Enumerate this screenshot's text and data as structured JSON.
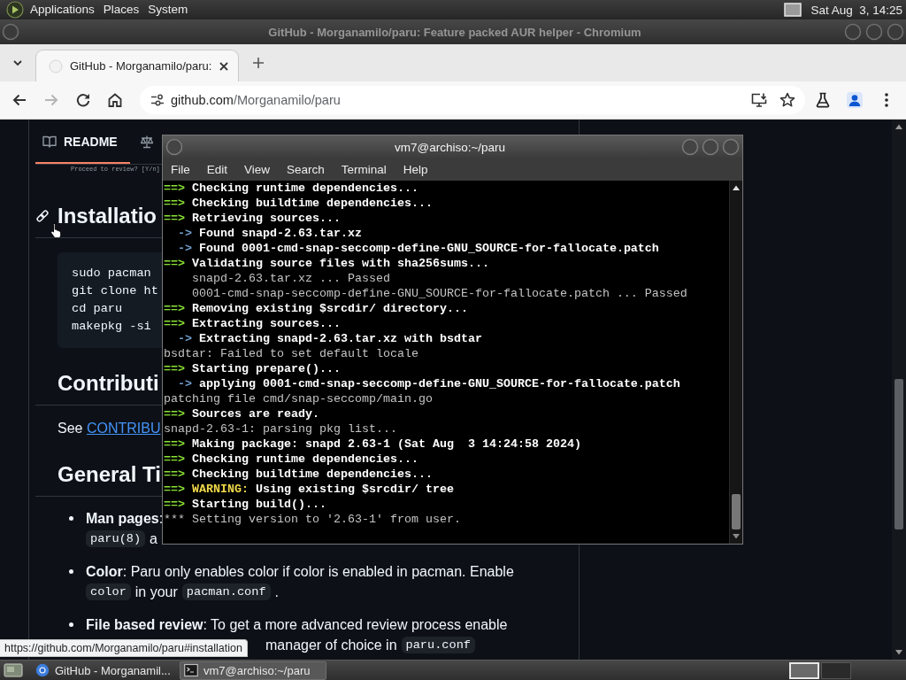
{
  "top_panel": {
    "menus": [
      "Applications",
      "Places",
      "System"
    ],
    "clock": "Sat Aug  3, 14:25"
  },
  "browser": {
    "title": "GitHub - Morganamilo/paru: Feature packed AUR helper - Chromium",
    "focused": false,
    "tabs": [
      {
        "title": "GitHub - Morganamilo/paru:",
        "selected": true
      }
    ],
    "toolbar": {
      "back_disabled": false,
      "forward_disabled": true
    },
    "address": {
      "host": "github.com",
      "path": "/Morganamilo/paru"
    },
    "page": {
      "readme_tabs": [
        {
          "label": "README",
          "selected": true
        },
        {
          "selected": false
        }
      ],
      "image_text": "Proceed to review? [Y/n]",
      "blocks": [
        {
          "kind": "heading",
          "text": "Installatio",
          "anchor_hovered": true
        },
        {
          "kind": "code",
          "lines": [
            "sudo pacman",
            "git clone ht",
            "cd paru",
            "makepkg -si"
          ]
        },
        {
          "kind": "heading",
          "text": "Contributi",
          "anchor_hovered": false
        },
        {
          "kind": "paragraph",
          "text": "See",
          "link": "CONTRIBU"
        },
        {
          "kind": "heading",
          "text": "General Ti",
          "anchor_hovered": false
        },
        {
          "kind": "list",
          "items": [
            {
              "lines": [
                [
                  {
                    "kind": "text",
                    "text": "**Man pages**:"
                  }
                ],
                [
                  {
                    "kind": "code",
                    "text": "paru(8)"
                  },
                  {
                    "kind": "text",
                    "text": "a"
                  }
                ]
              ]
            },
            {
              "lines": [
                [
                  {
                    "kind": "text",
                    "text": "**Color**: Paru only enables color if color is enabled in pacman. Enable"
                  }
                ],
                [
                  {
                    "kind": "code",
                    "text": "color"
                  },
                  {
                    "kind": "text",
                    "text": "in your"
                  },
                  {
                    "kind": "code",
                    "text": "pacman.conf"
                  },
                  {
                    "kind": "text",
                    "text": "."
                  }
                ]
              ]
            },
            {
              "lines": [
                [
                  {
                    "kind": "text",
                    "text": "**File based review**: To get a more advanced review process enable"
                  }
                ],
                [
                  {
                    "kind": "text",
                    "text": "manager of choice in"
                  },
                  {
                    "kind": "code",
                    "text": "paru.conf"
                  }
                ]
              ]
            }
          ]
        }
      ],
      "status_url": "https://github.com/Morganamilo/paru#installation"
    }
  },
  "terminal": {
    "title": "vm7@archiso:~/paru",
    "focused": true,
    "menus": [
      "File",
      "Edit",
      "View",
      "Search",
      "Terminal",
      "Help"
    ],
    "lines": [
      {
        "kind": "step",
        "marker": "==>",
        "text": "Checking runtime dependencies..."
      },
      {
        "kind": "step",
        "marker": "==>",
        "text": "Checking buildtime dependencies..."
      },
      {
        "kind": "step",
        "marker": "==>",
        "text": "Retrieving sources..."
      },
      {
        "kind": "substep",
        "marker": "->",
        "text": "Found snapd-2.63.tar.xz"
      },
      {
        "kind": "substep",
        "marker": "->",
        "text": "Found 0001-cmd-snap-seccomp-define-GNU_SOURCE-for-fallocate.patch"
      },
      {
        "kind": "step",
        "marker": "==>",
        "text": "Validating source files with sha256sums..."
      },
      {
        "kind": "detail",
        "text": "snapd-2.63.tar.xz ... Passed"
      },
      {
        "kind": "detail",
        "text": "0001-cmd-snap-seccomp-define-GNU_SOURCE-for-fallocate.patch ... Passed"
      },
      {
        "kind": "step",
        "marker": "==>",
        "text": "Removing existing $srcdir/ directory..."
      },
      {
        "kind": "step",
        "marker": "==>",
        "text": "Extracting sources..."
      },
      {
        "kind": "substep",
        "marker": "->",
        "text": "Extracting snapd-2.63.tar.xz with bsdtar"
      },
      {
        "kind": "plain",
        "text": "bsdtar: Failed to set default locale"
      },
      {
        "kind": "step",
        "marker": "==>",
        "text": "Starting prepare()..."
      },
      {
        "kind": "substep",
        "marker": "->",
        "text": "applying 0001-cmd-snap-seccomp-define-GNU_SOURCE-for-fallocate.patch"
      },
      {
        "kind": "plain",
        "text": "patching file cmd/snap-seccomp/main.go"
      },
      {
        "kind": "step",
        "marker": "==>",
        "text": "Sources are ready."
      },
      {
        "kind": "plain",
        "text": "snapd-2.63-1: parsing pkg list..."
      },
      {
        "kind": "step",
        "marker": "==>",
        "text": "Making package: snapd 2.63-1 (Sat Aug  3 14:24:58 2024)"
      },
      {
        "kind": "step",
        "marker": "==>",
        "text": "Checking runtime dependencies..."
      },
      {
        "kind": "step",
        "marker": "==>",
        "text": "Checking buildtime dependencies..."
      },
      {
        "kind": "warning",
        "marker": "==>",
        "label": "WARNING:",
        "text": "Using existing $srcdir/ tree"
      },
      {
        "kind": "step",
        "marker": "==>",
        "text": "Starting build()..."
      },
      {
        "kind": "plain",
        "text": "*** Setting version to '2.63-1' from user."
      }
    ]
  },
  "taskbar": {
    "tasks": [
      {
        "title": "GitHub - Morganamil...",
        "kind": "browser",
        "selected": false
      },
      {
        "title": "vm7@archiso:~/paru",
        "kind": "terminal",
        "selected": true
      }
    ],
    "workspaces": [
      {
        "selected": true
      },
      {
        "selected": false
      }
    ]
  }
}
